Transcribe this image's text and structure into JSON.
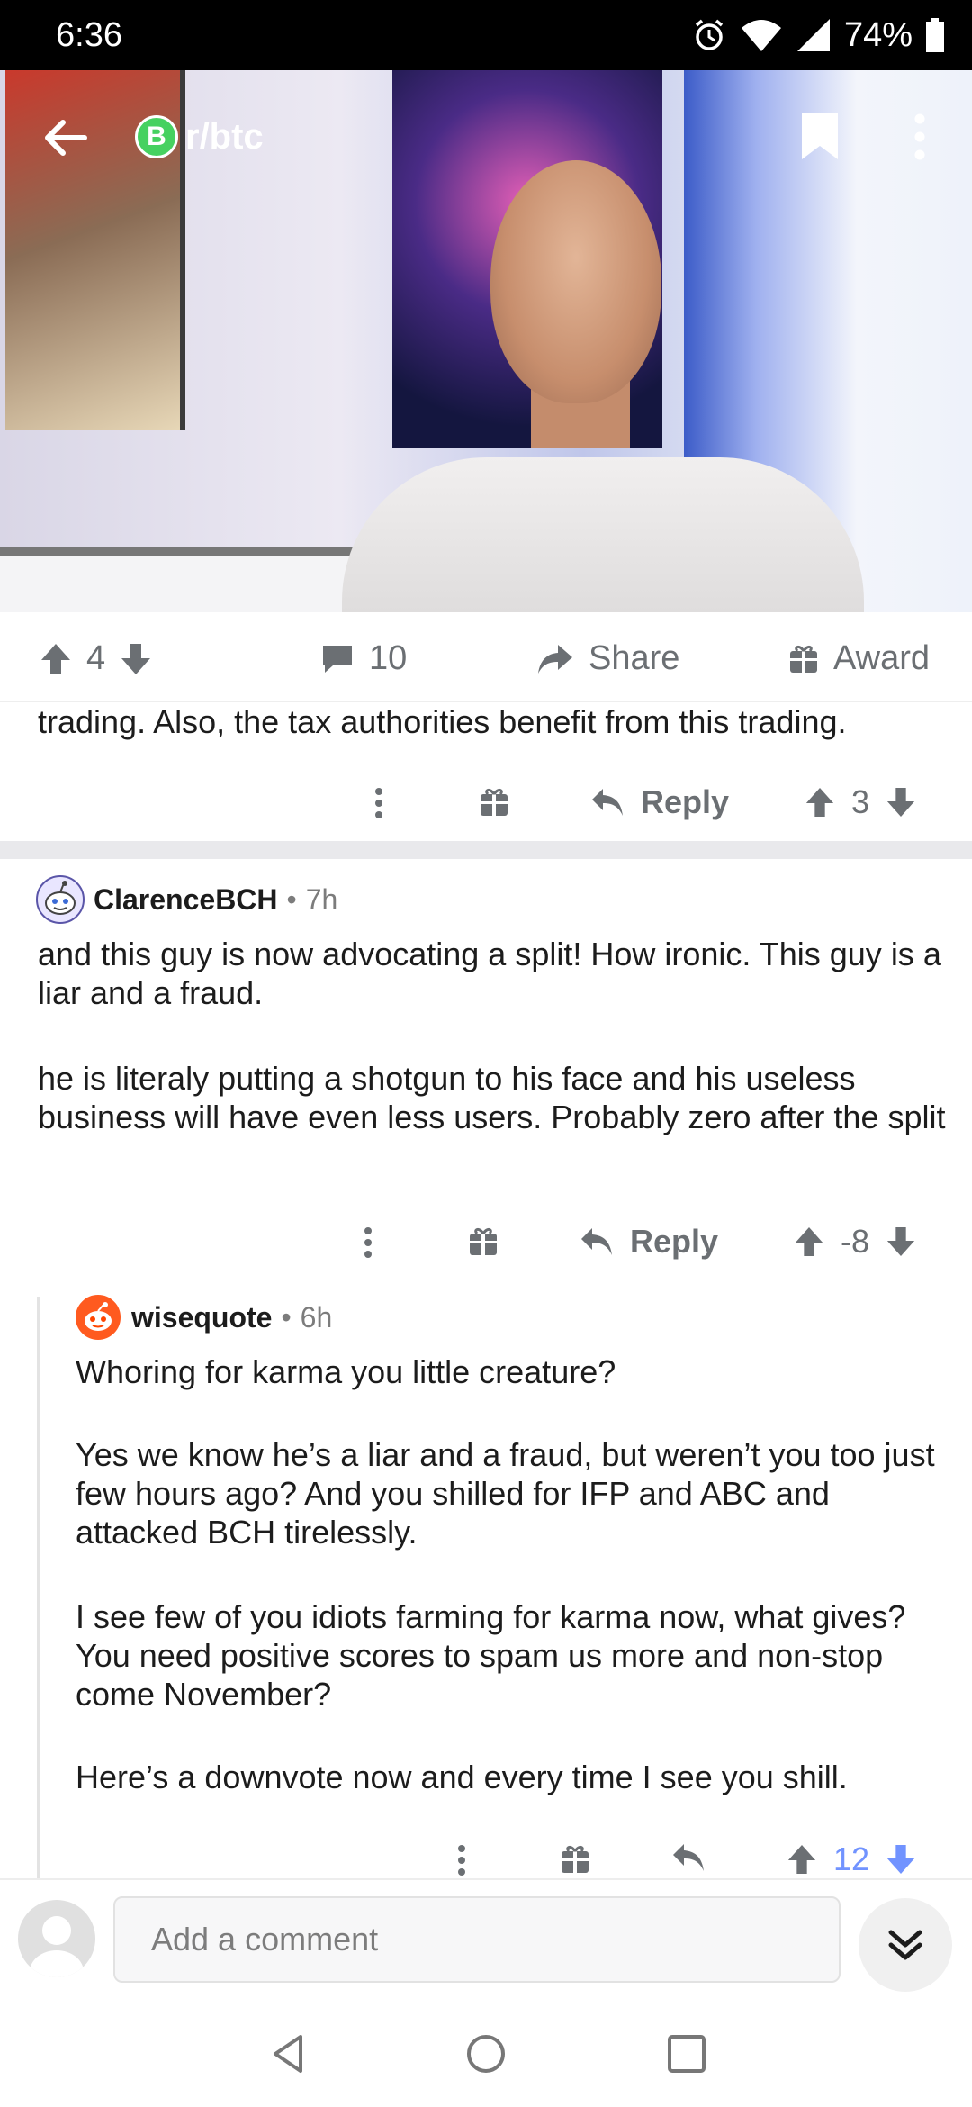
{
  "status_bar": {
    "time": "6:36",
    "battery": "74%"
  },
  "header": {
    "subreddit": "r/btc",
    "sub_icon_letter": "B"
  },
  "post_actions": {
    "score": "4",
    "comments": "10",
    "share_label": "Share",
    "award_label": "Award"
  },
  "truncated_comment": {
    "text": "trading.  Also,  the tax authorities benefit from this trading.",
    "reply_label": "Reply",
    "score": "3"
  },
  "comments": [
    {
      "user": "ClarenceBCH",
      "age": "7h",
      "paragraphs": [
        "and this guy is now advocating a split! How ironic. This guy is a liar and a fraud.",
        "he is literaly putting a shotgun to his face and his useless business will have even less users. Probably zero after the split"
      ],
      "reply_label": "Reply",
      "score": "-8"
    },
    {
      "user": "wisequote",
      "age": "6h",
      "paragraphs": [
        "Whoring for karma you little creature?",
        "Yes we know he’s a liar and a fraud, but weren’t you too just few hours ago? And you shilled for IFP and ABC and attacked BCH tirelessly.",
        "I see few of you idiots farming for karma now, what gives? You need positive scores to spam us more and non-stop come November?",
        "Here’s a downvote now and every time I see you shill."
      ],
      "score": "12"
    }
  ],
  "comment_bar": {
    "placeholder": "Add a comment"
  },
  "colors": {
    "downvote_active": "#7193ff",
    "btc_green": "#46d160",
    "meta_gray": "#7c7c7c"
  }
}
